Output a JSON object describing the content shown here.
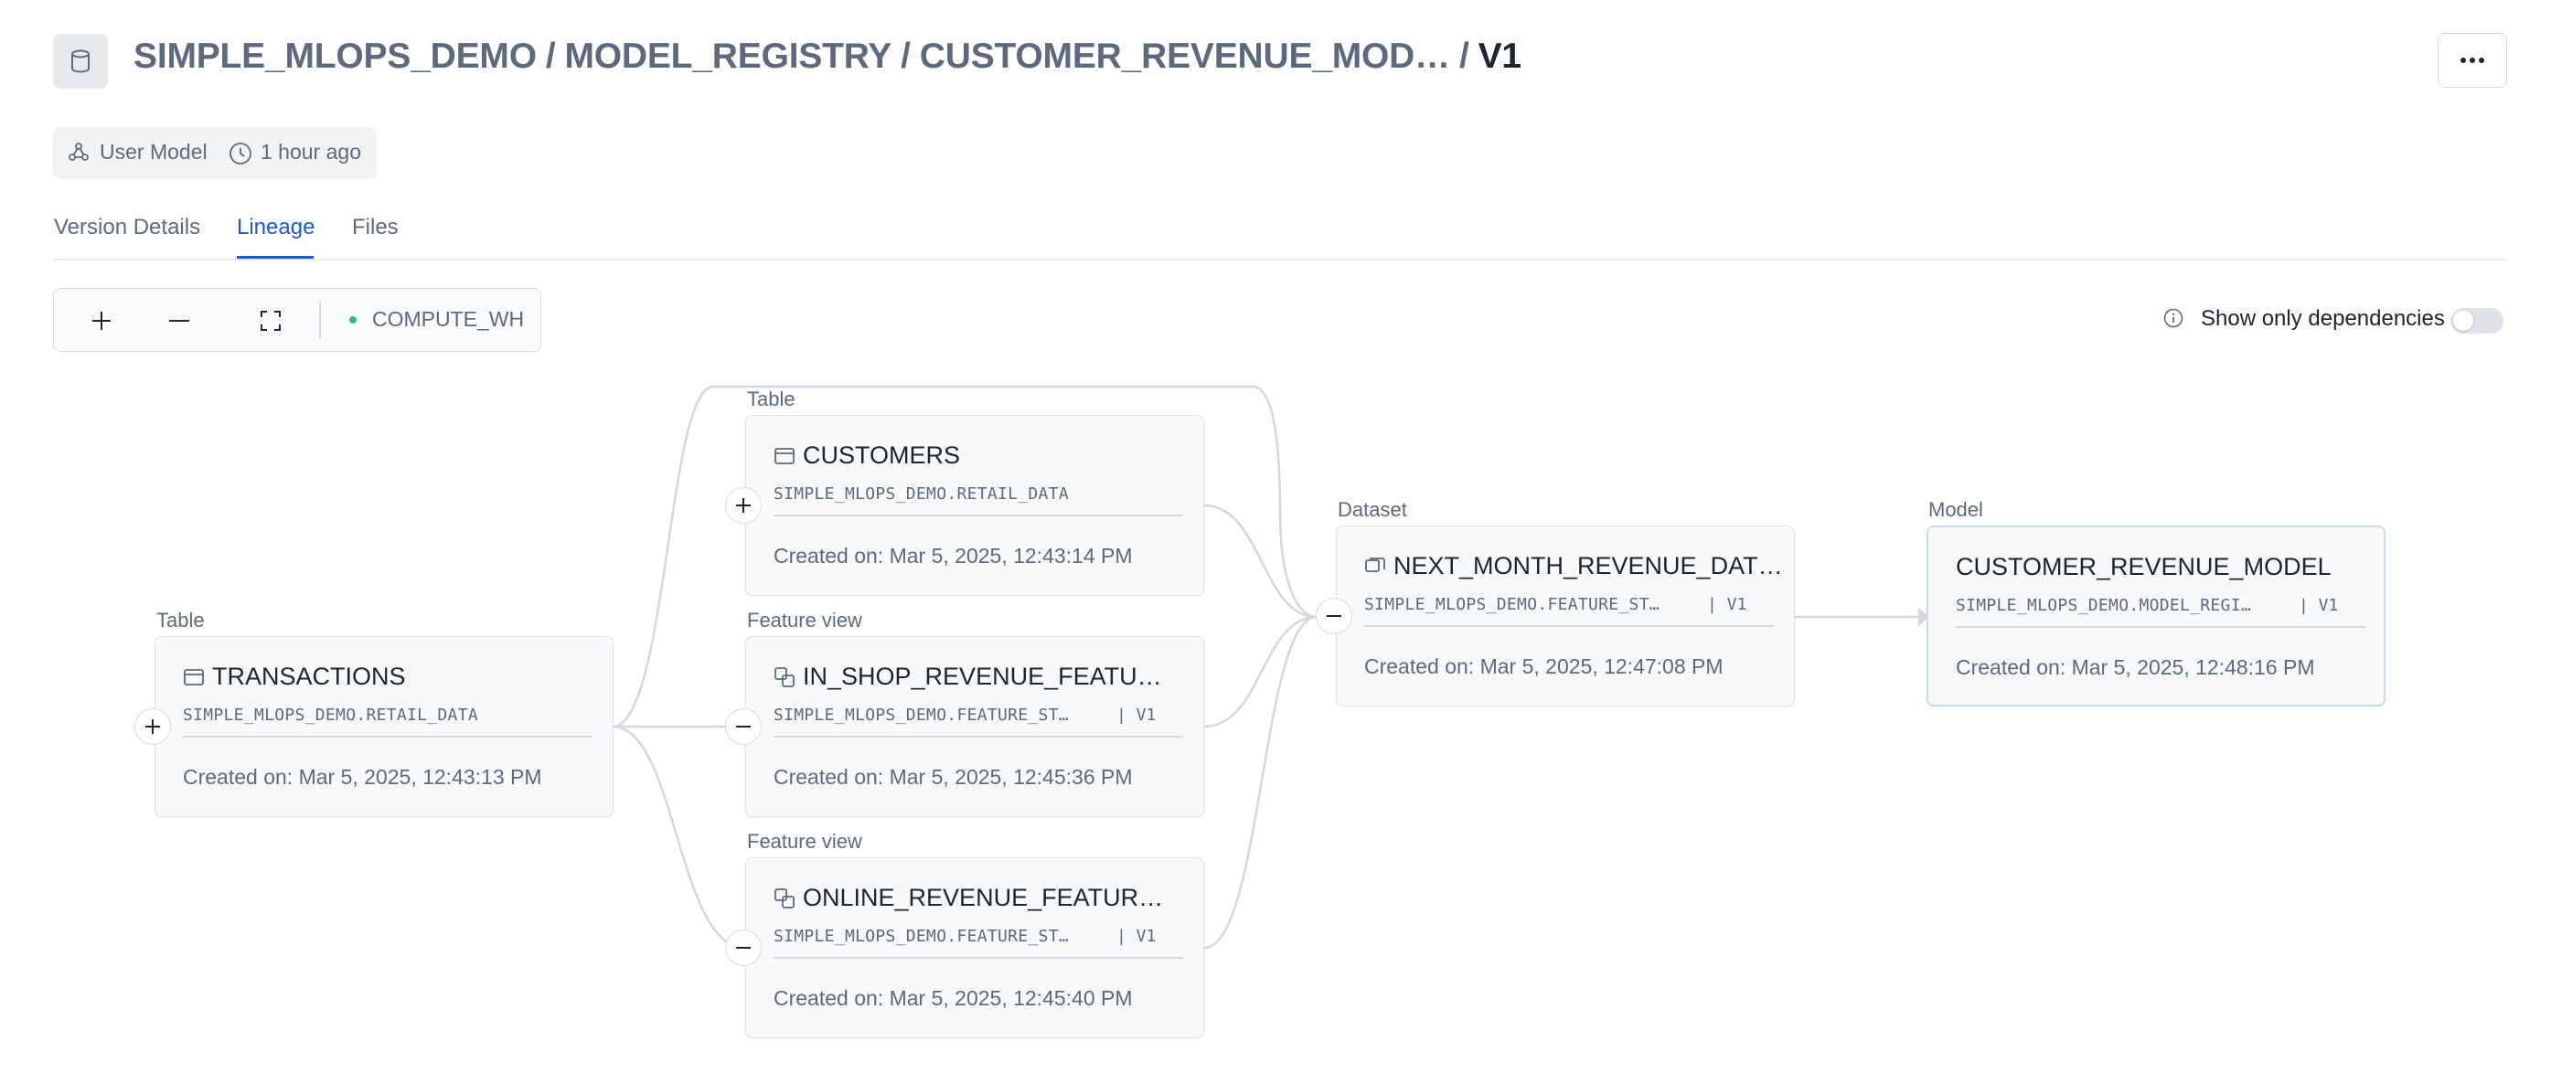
{
  "header": {
    "breadcrumb": [
      "SIMPLE_MLOPS_DEMO",
      "MODEL_REGISTRY",
      "CUSTOMER_REVENUE_MOD…"
    ],
    "version": "V1",
    "more_icon": "more-horizontal-icon",
    "db_icon": "database-icon"
  },
  "meta": {
    "model_type": "User Model",
    "updated": "1 hour ago"
  },
  "tabs": [
    {
      "label": "Version Details",
      "active": false
    },
    {
      "label": "Lineage",
      "active": true
    },
    {
      "label": "Files",
      "active": false
    }
  ],
  "toolbar": {
    "warehouse": "COMPUTE_WH",
    "warehouse_status_color": "#2dbb84"
  },
  "dependencies": {
    "label": "Show only dependencies",
    "enabled": false
  },
  "graph": {
    "nodes": [
      {
        "id": "transactions",
        "type": "Table",
        "title": "TRANSACTIONS",
        "path": "SIMPLE_MLOPS_DEMO.RETAIL_DATA",
        "version": "",
        "created": "Created on: Mar 5, 2025, 12:43:13 PM",
        "expander": "+"
      },
      {
        "id": "customers",
        "type": "Table",
        "title": "CUSTOMERS",
        "path": "SIMPLE_MLOPS_DEMO.RETAIL_DATA",
        "version": "",
        "created": "Created on: Mar 5, 2025, 12:43:14 PM",
        "expander": "+"
      },
      {
        "id": "in_shop",
        "type": "Feature view",
        "title": "IN_SHOP_REVENUE_FEATU…",
        "path": "SIMPLE_MLOPS_DEMO.FEATURE_ST…",
        "version": "| V1",
        "created": "Created on: Mar 5, 2025, 12:45:36 PM",
        "expander": "–"
      },
      {
        "id": "online",
        "type": "Feature view",
        "title": "ONLINE_REVENUE_FEATUR…",
        "path": "SIMPLE_MLOPS_DEMO.FEATURE_ST…",
        "version": "| V1",
        "created": "Created on: Mar 5, 2025, 12:45:40 PM",
        "expander": "–"
      },
      {
        "id": "dataset",
        "type": "Dataset",
        "title": "NEXT_MONTH_REVENUE_DAT…",
        "path": "SIMPLE_MLOPS_DEMO.FEATURE_ST…",
        "version": "| V1",
        "created": "Created on: Mar 5, 2025, 12:47:08 PM",
        "expander": "–"
      },
      {
        "id": "model",
        "type": "Model",
        "title": "CUSTOMER_REVENUE_MODEL",
        "path": "SIMPLE_MLOPS_DEMO.MODEL_REGI…",
        "version": "| V1",
        "created": "Created on: Mar 5, 2025, 12:48:16 PM",
        "expander": ""
      }
    ],
    "edges": [
      [
        "transactions",
        "customers"
      ],
      [
        "transactions",
        "in_shop"
      ],
      [
        "transactions",
        "online"
      ],
      [
        "customers",
        "dataset"
      ],
      [
        "in_shop",
        "dataset"
      ],
      [
        "online",
        "dataset"
      ],
      [
        "dataset",
        "model"
      ]
    ]
  }
}
